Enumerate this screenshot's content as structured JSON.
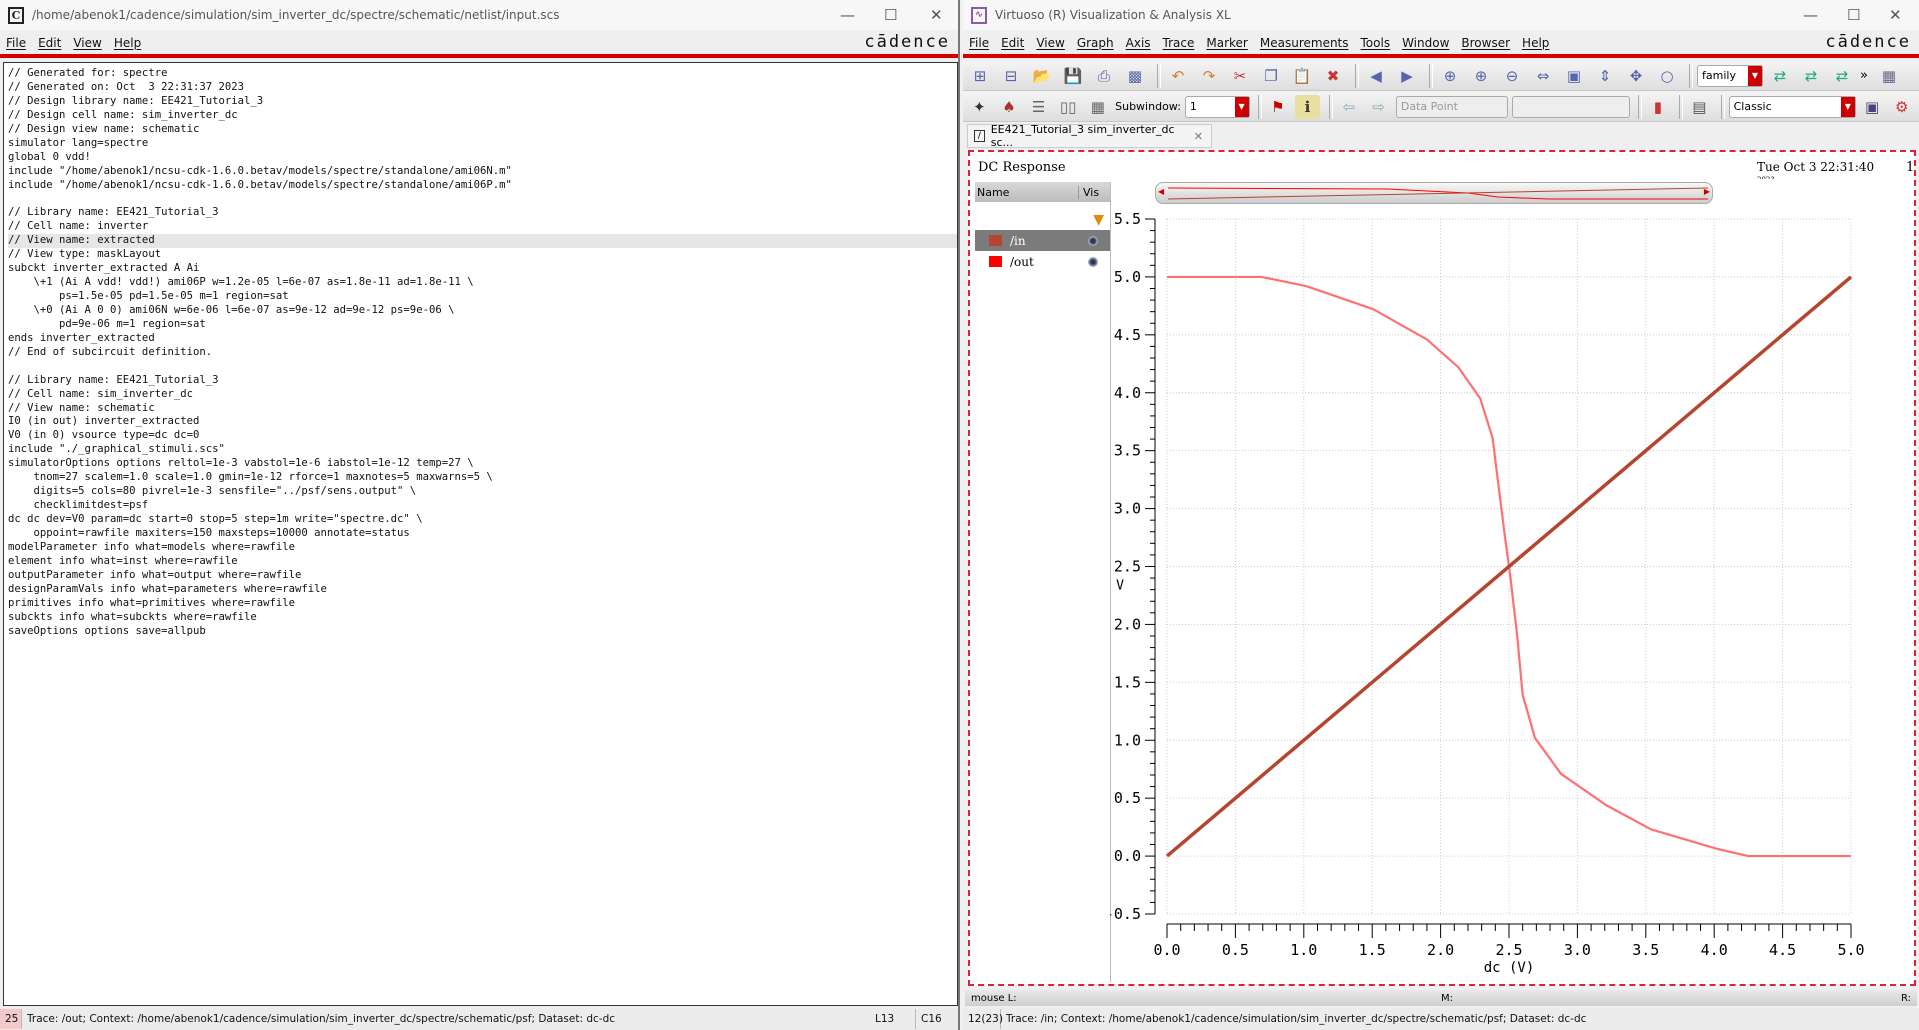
{
  "left_window": {
    "title": "/home/abenok1/cadence/simulation/sim_inverter_dc/spectre/schematic/netlist/input.scs",
    "app_icon": "C",
    "menu": [
      "File",
      "Edit",
      "View",
      "Help"
    ],
    "brand": "cādence",
    "netlist_lines": [
      "// Generated for: spectre",
      "// Generated on: Oct  3 22:31:37 2023",
      "// Design library name: EE421_Tutorial_3",
      "// Design cell name: sim_inverter_dc",
      "// Design view name: schematic",
      "simulator lang=spectre",
      "global 0 vdd!",
      "include \"/home/abenok1/ncsu-cdk-1.6.0.betav/models/spectre/standalone/ami06N.m\"",
      "include \"/home/abenok1/ncsu-cdk-1.6.0.betav/models/spectre/standalone/ami06P.m\"",
      "",
      "// Library name: EE421_Tutorial_3",
      "// Cell name: inverter",
      "// View name: extracted",
      "// View type: maskLayout",
      "subckt inverter_extracted A Ai",
      "    \\+1 (Ai A vdd! vdd!) ami06P w=1.2e-05 l=6e-07 as=1.8e-11 ad=1.8e-11 \\",
      "        ps=1.5e-05 pd=1.5e-05 m=1 region=sat",
      "    \\+0 (Ai A 0 0) ami06N w=6e-06 l=6e-07 as=9e-12 ad=9e-12 ps=9e-06 \\",
      "        pd=9e-06 m=1 region=sat",
      "ends inverter_extracted",
      "// End of subcircuit definition.",
      "",
      "// Library name: EE421_Tutorial_3",
      "// Cell name: sim_inverter_dc",
      "// View name: schematic",
      "I0 (in out) inverter_extracted",
      "V0 (in 0) vsource type=dc dc=0",
      "include \"./_graphical_stimuli.scs\"",
      "simulatorOptions options reltol=1e-3 vabstol=1e-6 iabstol=1e-12 temp=27 \\",
      "    tnom=27 scalem=1.0 scale=1.0 gmin=1e-12 rforce=1 maxnotes=5 maxwarns=5 \\",
      "    digits=5 cols=80 pivrel=1e-3 sensfile=\"../psf/sens.output\" \\",
      "    checklimitdest=psf",
      "dc dc dev=V0 param=dc start=0 stop=5 step=1m write=\"spectre.dc\" \\",
      "    oppoint=rawfile maxiters=150 maxsteps=10000 annotate=status",
      "modelParameter info what=models where=rawfile",
      "element info what=inst where=rawfile",
      "outputParameter info what=output where=rawfile",
      "designParamVals info what=parameters where=rawfile",
      "primitives info what=primitives where=rawfile",
      "subckts info what=subckts where=rawfile",
      "saveOptions options save=allpub"
    ],
    "highlighted_line": 12,
    "status": {
      "count": "25",
      "message": "Trace: /out; Context: /home/abenok1/cadence/simulation/sim_inverter_dc/spectre/schematic/psf; Dataset: dc-dc",
      "line": "L13",
      "col": "C16"
    }
  },
  "right_window": {
    "title": "Virtuoso (R) Visualization & Analysis XL",
    "menu": [
      "File",
      "Edit",
      "View",
      "Graph",
      "Axis",
      "Trace",
      "Marker",
      "Measurements",
      "Tools",
      "Window",
      "Browser",
      "Help"
    ],
    "brand": "cādence",
    "toolbar1": {
      "icons": [
        "new-window-icon",
        "new-subwindow-icon",
        "open-icon",
        "save-icon",
        "print-icon",
        "export-image-icon",
        "undo-icon",
        "redo-icon",
        "cut-icon",
        "copy-icon",
        "paste-icon",
        "delete-icon",
        "back-icon",
        "forward-icon",
        "zoom-fit-icon",
        "zoom-in-icon",
        "zoom-out-icon",
        "zoom-x-icon",
        "zoom-box-icon",
        "zoom-y-icon",
        "zoom-xy-icon",
        "zoom-reset-icon"
      ],
      "family_select": "family",
      "more": "»"
    },
    "toolbar2": {
      "subwindow_label": "Subwindow:",
      "subwindow_value": "1",
      "data_point": "Data Point",
      "style_select": "Classic"
    },
    "tab_label": "EE421_Tutorial_3 sim_inverter_dc sc...",
    "plot": {
      "title": "DC Response",
      "timestamp": "Tue Oct 3 22:31:40",
      "timestamp_year": "2023",
      "subwindow_number": "1",
      "trace_list_headers": [
        "Name",
        "Vis"
      ],
      "traces": [
        {
          "name": "/in",
          "color": "#b5452f",
          "selected": true
        },
        {
          "name": "/out",
          "color": "#ff0000",
          "selected": false
        }
      ]
    },
    "mouse_bar": {
      "left": "mouse L:",
      "middle": "M:",
      "right": "R:"
    },
    "status": {
      "count": "12(23)",
      "message": "Trace: /in; Context: /home/abenok1/cadence/simulation/sim_inverter_dc/spectre/schematic/psf; Dataset: dc-dc"
    }
  },
  "chart_data": {
    "type": "line",
    "title": "DC Response",
    "xlabel": "dc (V)",
    "ylabel": "V",
    "xlim": [
      0,
      5
    ],
    "ylim": [
      -0.5,
      5.5
    ],
    "xticks": [
      "0.0",
      "0.5",
      "1.0",
      "1.5",
      "2.0",
      "2.5",
      "3.0",
      "3.5",
      "4.0",
      "4.5",
      "5.0"
    ],
    "yticks": [
      "-0.5",
      "0.0",
      "0.5",
      "1.0",
      "1.5",
      "2.0",
      "2.5",
      "3.0",
      "3.5",
      "4.0",
      "4.5",
      "5.0",
      "5.5"
    ],
    "grid": true,
    "series": [
      {
        "name": "/in",
        "color": "#b5452f",
        "x": [
          0,
          5
        ],
        "y": [
          0,
          5
        ]
      },
      {
        "name": "/out",
        "color": "#ff7070",
        "x": [
          0,
          0.69,
          1.02,
          1.51,
          1.9,
          2.13,
          2.29,
          2.38,
          2.42,
          2.47,
          2.51,
          2.56,
          2.6,
          2.69,
          2.88,
          3.21,
          3.54,
          4.03,
          4.25,
          5.0
        ],
        "y": [
          5.0,
          5.0,
          4.92,
          4.72,
          4.46,
          4.22,
          3.95,
          3.61,
          3.23,
          2.76,
          2.41,
          1.9,
          1.39,
          1.02,
          0.71,
          0.44,
          0.23,
          0.06,
          0.0,
          0.0
        ]
      }
    ]
  }
}
